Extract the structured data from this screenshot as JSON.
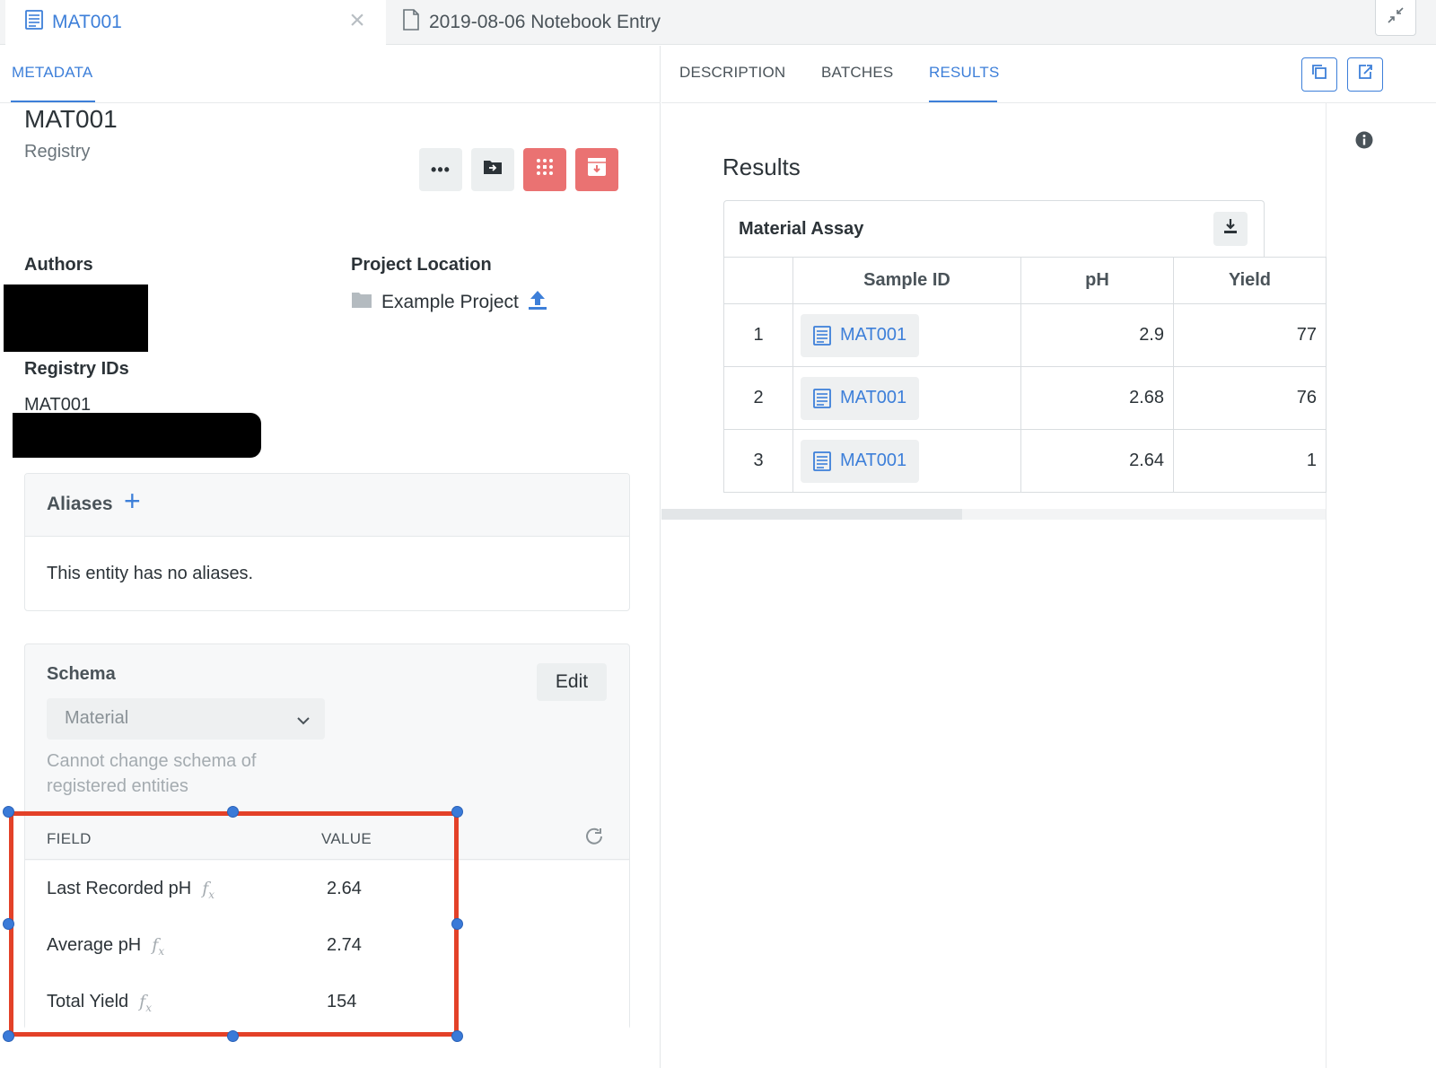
{
  "tabs": {
    "entity_tab_label": "MAT001",
    "notebook_tab_label": "2019-08-06 Notebook Entry"
  },
  "left": {
    "subtab": "METADATA",
    "entity_name": "MAT001",
    "entity_type": "Registry",
    "authors_label": "Authors",
    "project_location_label": "Project Location",
    "project_name": "Example Project",
    "registry_ids_label": "Registry IDs",
    "registry_id": "MAT001",
    "aliases_title": "Aliases",
    "aliases_empty": "This entity has no aliases.",
    "schema_title": "Schema",
    "edit_label": "Edit",
    "schema_value": "Material",
    "schema_note": "Cannot change schema of registered entities",
    "field_header": "FIELD",
    "value_header": "VALUE",
    "fields": [
      {
        "field": "Last Recorded pH",
        "value": "2.64"
      },
      {
        "field": "Average pH",
        "value": "2.74"
      },
      {
        "field": "Total Yield",
        "value": "154"
      }
    ]
  },
  "right": {
    "tabs": [
      "DESCRIPTION",
      "BATCHES",
      "RESULTS"
    ],
    "active_tab": "RESULTS",
    "results_title": "Results",
    "assay_title": "Material Assay",
    "columns": [
      "Sample ID",
      "pH",
      "Yield"
    ],
    "rows": [
      {
        "n": "1",
        "sample": "MAT001",
        "ph": "2.9",
        "yield": "77"
      },
      {
        "n": "2",
        "sample": "MAT001",
        "ph": "2.68",
        "yield": "76"
      },
      {
        "n": "3",
        "sample": "MAT001",
        "ph": "2.64",
        "yield": "1"
      }
    ]
  },
  "colors": {
    "accent": "#3d7fd9",
    "danger": "#ea7272",
    "selection": "#e34128",
    "handle": "#3a7ad8"
  }
}
